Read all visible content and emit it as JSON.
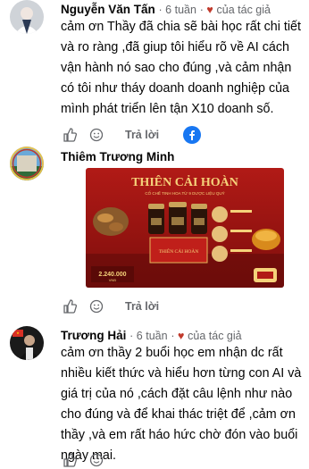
{
  "comments": [
    {
      "name": "Nguyễn Văn Tấn",
      "time": "6 tuần",
      "author_tag": "của tác giả",
      "text": "cảm ơn Thầy đã chia sẽ bài học rất chi tiết và ro ràng ,đã giup tôi hiểu rõ về AI cách vận hành nó sao cho đúng ,và cảm nhận có tôi như tháy doanh doanh nghiệp của mình phát triển lên tận X10 doanh số.",
      "reply_label": "Trả lời"
    },
    {
      "name": "Thiêm Trương Minh",
      "time": "",
      "author_tag": "",
      "text": "",
      "reply_label": "Trả lời",
      "image": {
        "title": "THIÊN CẢI HOÀN",
        "subtitle": "CỐ CHẾ TINH HOA TỪ 9 DƯỢC LIỆU QUÝ",
        "box_label": "THIÊN CẢI HOÀN",
        "price": "2.240.000",
        "price_unit": "VNĐ"
      }
    },
    {
      "name": "Trương Hải",
      "time": "6 tuần",
      "author_tag": "của tác giả",
      "text": "cảm ơn thầy 2 buổi học em nhận dc rất nhiều kiết thức và hiểu hơn từng con AI và giá trị của nó ,cách đặt câu lệnh như nào cho đúng và để khai thác triệt để ,cảm ơn thầy ,và em rất háo hức chờ đón vào buổi ngày mai.",
      "reply_label": ""
    }
  ],
  "icons": {
    "like": "thumbs-up-icon",
    "reaction": "smiley-icon",
    "messenger": "facebook-icon",
    "avatar_flag": "flag-icon"
  },
  "colors": {
    "link_blue": "#1877f2",
    "meta_gray": "#65676b",
    "red": "#d93025"
  }
}
